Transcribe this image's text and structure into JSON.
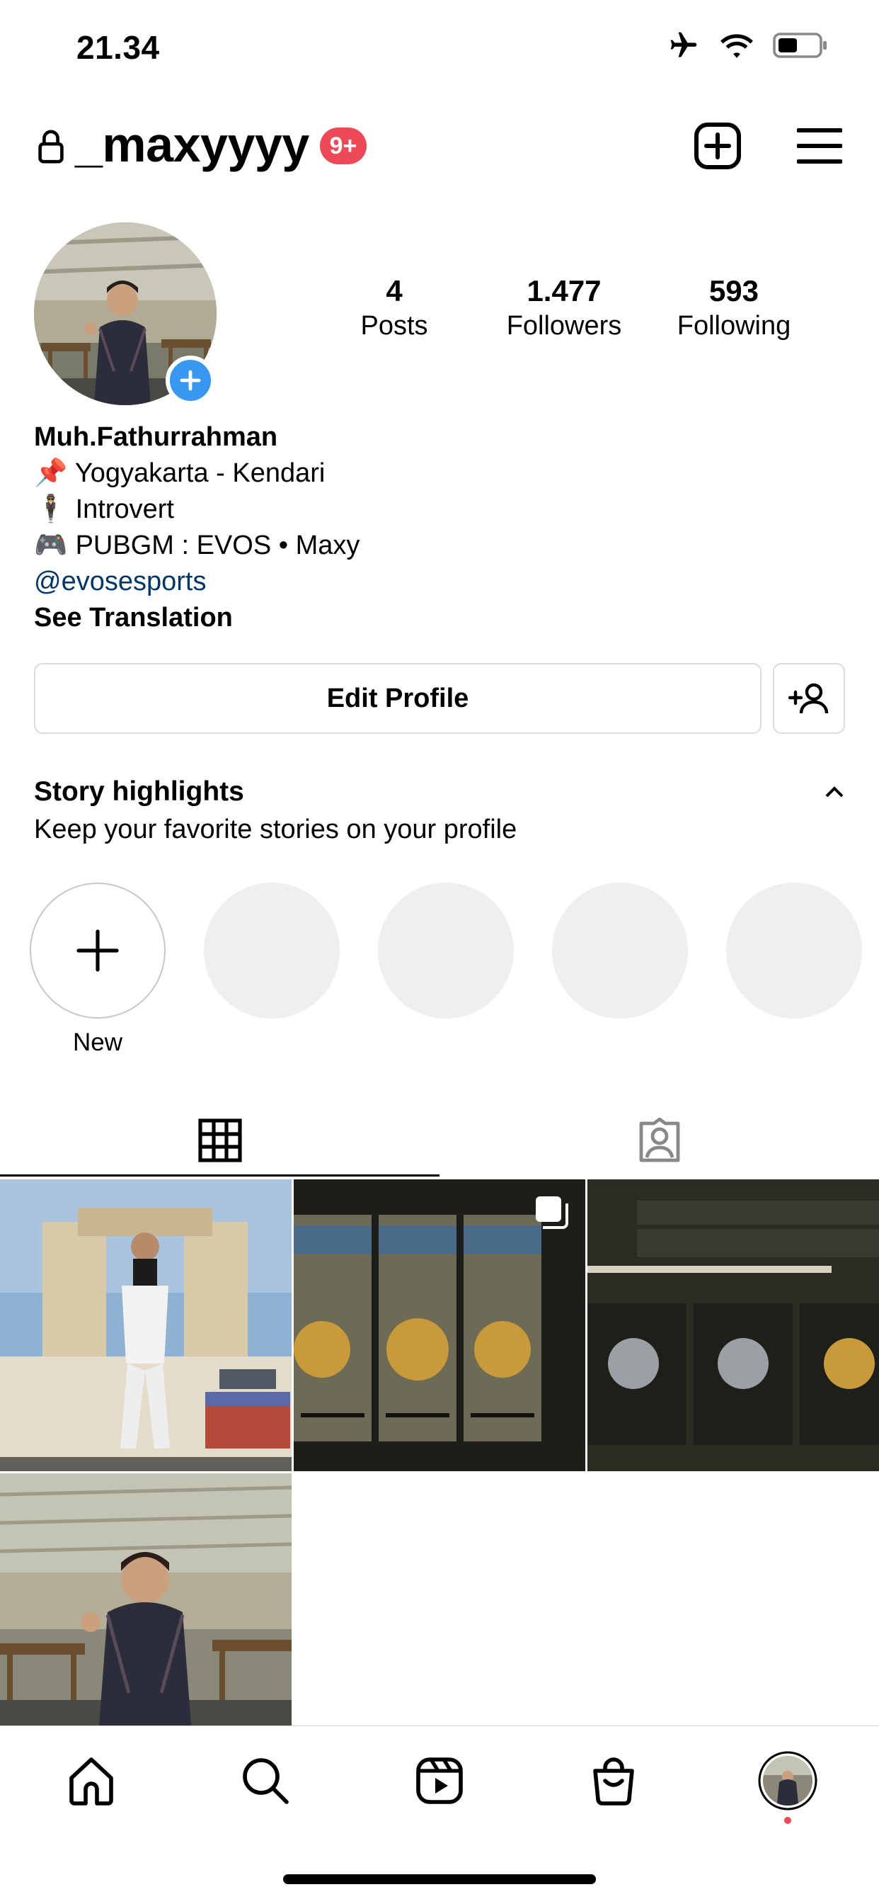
{
  "status_bar": {
    "time": "21.34",
    "icons": [
      "airplane-icon",
      "wifi-icon",
      "battery-icon"
    ]
  },
  "header": {
    "username": "_maxyyyy",
    "notification_badge": "9+",
    "icons": [
      "lock-icon",
      "new-post-icon",
      "menu-icon"
    ]
  },
  "stats": [
    {
      "value": "4",
      "label": "Posts"
    },
    {
      "value": "1.477",
      "label": "Followers"
    },
    {
      "value": "593",
      "label": "Following"
    }
  ],
  "bio": {
    "name": "Muh.Fathurrahman",
    "lines": [
      {
        "emoji": "📌",
        "text": "Yogyakarta - Kendari"
      },
      {
        "emoji": "🕴",
        "text": "Introvert"
      },
      {
        "emoji": "🎮",
        "text": "PUBGM : EVOS • Maxy"
      }
    ],
    "link": "@evosesports",
    "see_translation": "See Translation"
  },
  "actions": {
    "edit_profile": "Edit Profile"
  },
  "highlights": {
    "title": "Story highlights",
    "subtitle": "Keep your favorite stories on your profile",
    "new_label": "New"
  },
  "colors": {
    "accent": "#3897f0",
    "badge": "#ed4956",
    "link": "#00376b",
    "nav_dot": "#ed4956"
  }
}
